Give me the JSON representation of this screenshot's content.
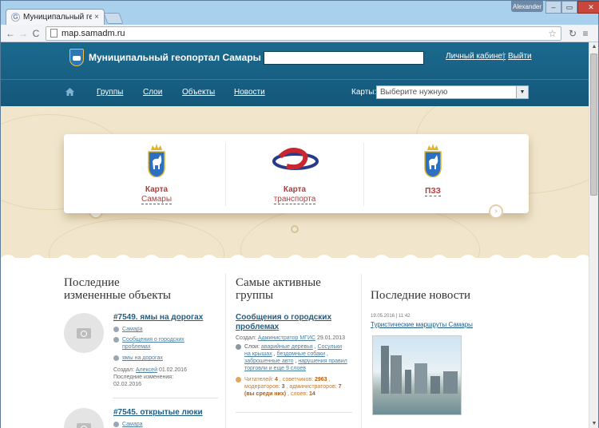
{
  "browser": {
    "tab_title": "Муниципальный геопор",
    "tab_favicon": "G",
    "tab_close": "×",
    "url": "map.samadm.ru",
    "user_name": "Alexander",
    "window_buttons": [
      "–",
      "▭",
      "✕"
    ]
  },
  "header": {
    "site_title": "Муниципальный геопортал Самары",
    "links": {
      "cabinet": "Личный кабинет",
      "logout": "Выйти"
    },
    "menu": [
      "Группы",
      "Слои",
      "Объекты",
      "Новости"
    ],
    "maps_label": "Карты:",
    "maps_select": "Выберите нужную"
  },
  "carousel": {
    "items": [
      {
        "title": "Карта",
        "subtitle": "Самары",
        "icon": "samara-coat-of-arms-icon"
      },
      {
        "title": "Карта",
        "subtitle": "транспорта",
        "icon": "transport-logo-icon"
      },
      {
        "title": "ПЗЗ",
        "subtitle": "",
        "icon": "samara-coat-of-arms-icon"
      }
    ],
    "prev": "‹",
    "next": "›"
  },
  "columns": {
    "objects": {
      "heading_1": "Последние",
      "heading_2": "измененные объекты",
      "items": [
        {
          "title": "#7549. ямы на дорогах",
          "tags": [
            "Самара",
            "Сообщения о городских",
            "проблемах",
            "ямы на дорогах"
          ],
          "created_label": "Создал:",
          "author": "Алексей",
          "created_date": "01.02.2016",
          "changed_label": "Последние изменения:",
          "changed_date": "02.02.2016"
        },
        {
          "title": "#7545. открытые люки",
          "tags": [
            "Самара"
          ]
        }
      ]
    },
    "groups": {
      "heading_1": "Самые активные",
      "heading_2": "группы",
      "title_1": "Сообщения о городских",
      "title_2": "проблемах",
      "created_label": "Создал:",
      "author": "Администратор МГИС",
      "created_date": "29.01.2013",
      "layers_label": "Слои:",
      "layers_1": "аварийные деревья",
      "layers_2": "Сосульки",
      "layers_3": "на крышах",
      "layers_4": "бездомные собаки",
      "layers_5": "заброшенные авто",
      "layers_6": "нарушения правил",
      "layers_7": "торговли и еще 9 слоев",
      "readers_label": "Читателей:",
      "readers": "4",
      "advisors_label": "советчиков:",
      "advisors": "2963",
      "moderators_label": "модераторов:",
      "moderators": "3",
      "admins_label": "администраторов:",
      "admins": "7",
      "you_among": "(вы среди них)",
      "layers_count_label": "слоев:",
      "layers_count": "14"
    },
    "news": {
      "heading": "Последние новости",
      "date": "19.05.2016 | 11:42",
      "title": "Туристические маршруты Самары"
    }
  }
}
